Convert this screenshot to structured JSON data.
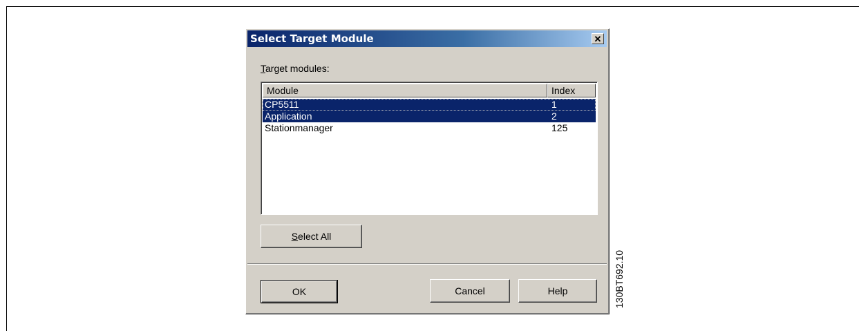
{
  "dialog": {
    "title": "Select Target Module",
    "close_glyph": "✕",
    "label_accel": "T",
    "label_rest": "arget modules:",
    "columns": {
      "module": "Module",
      "index": "Index"
    },
    "rows": [
      {
        "module": "CP5511",
        "index": "1",
        "selected": true
      },
      {
        "module": "Application",
        "index": "2",
        "selected": true
      },
      {
        "module": "Stationmanager",
        "index": "125",
        "selected": false
      }
    ],
    "select_all_accel": "S",
    "select_all_rest": "elect All",
    "ok_label": "OK",
    "cancel_label": "Cancel",
    "help_label": "Help"
  },
  "figure_code": "130BT692.10",
  "colors": {
    "selection": "#0a246a",
    "title_gradient_start": "#0a246a",
    "face": "#d4d0c8"
  }
}
